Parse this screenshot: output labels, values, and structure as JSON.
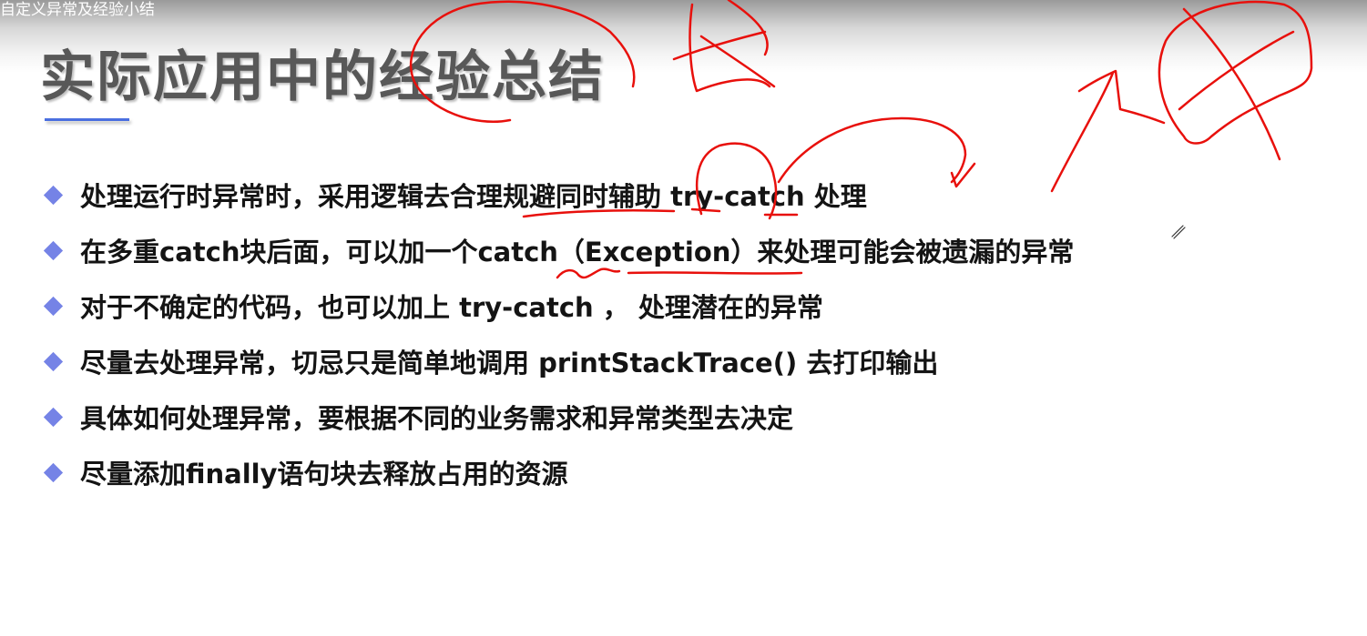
{
  "window_title": "自定义异常及经验小结",
  "slide": {
    "title": "实际应用中的经验总结",
    "accent_color": "#4a6fe0",
    "bullet_color": "#7583e6",
    "annotation_color": "#e8100c",
    "bullets": [
      {
        "text": "处理运行时异常时，采用逻辑去合理规避同时辅助 try-catch 处理"
      },
      {
        "text": "在多重catch块后面，可以加一个catch（Exception）来处理可能会被遗漏的异常"
      },
      {
        "text": "对于不确定的代码，也可以加上 try-catch ， 处理潜在的异常"
      },
      {
        "text": "尽量去处理异常，切忌只是简单地调用 printStackTrace() 去打印输出"
      },
      {
        "text": "具体如何处理异常，要根据不同的业务需求和异常类型去决定"
      },
      {
        "text": "尽量添加finally语句块去释放占用的资源"
      }
    ]
  }
}
